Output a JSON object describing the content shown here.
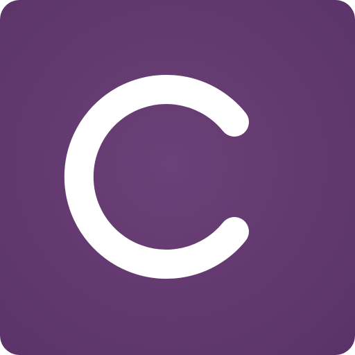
{
  "icon": {
    "name": "c-logo-icon",
    "glyph": "C",
    "colors": {
      "background_center": "#6c4078",
      "background_edge": "#5a3468",
      "glyph": "#ffffff"
    }
  }
}
